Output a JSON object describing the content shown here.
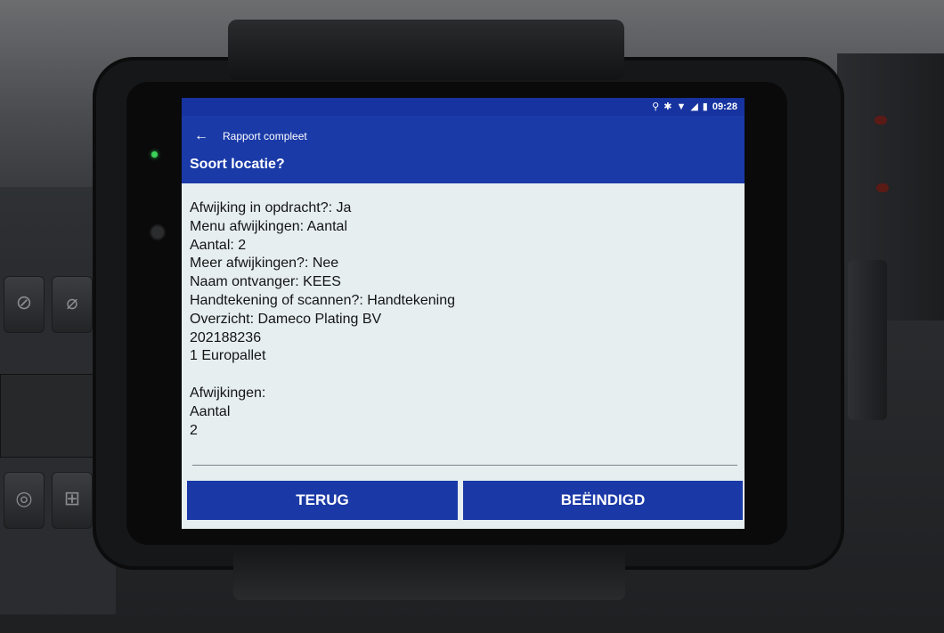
{
  "statusbar": {
    "icons": [
      "location-icon",
      "bluetooth-icon",
      "wifi-icon",
      "signal-icon",
      "battery-icon"
    ],
    "time": "09:28"
  },
  "appbar": {
    "title": "Rapport compleet",
    "heading": "Soort locatie?"
  },
  "summary": {
    "lines": [
      "Afwijking in opdracht?: Ja",
      "Menu afwijkingen: Aantal",
      "Aantal: 2",
      "Meer afwijkingen?: Nee",
      "Naam ontvanger: KEES",
      "Handtekening of scannen?: Handtekening",
      "Overzicht: Dameco Plating BV",
      "202188236",
      "1 Europallet",
      "",
      "Afwijkingen:",
      "Aantal",
      "2"
    ]
  },
  "buttons": {
    "back": "TERUG",
    "finish": "BEËINDIGD"
  },
  "colors": {
    "primary": "#1a3aa8",
    "content_bg": "#e6eef0",
    "text": "#141414"
  }
}
